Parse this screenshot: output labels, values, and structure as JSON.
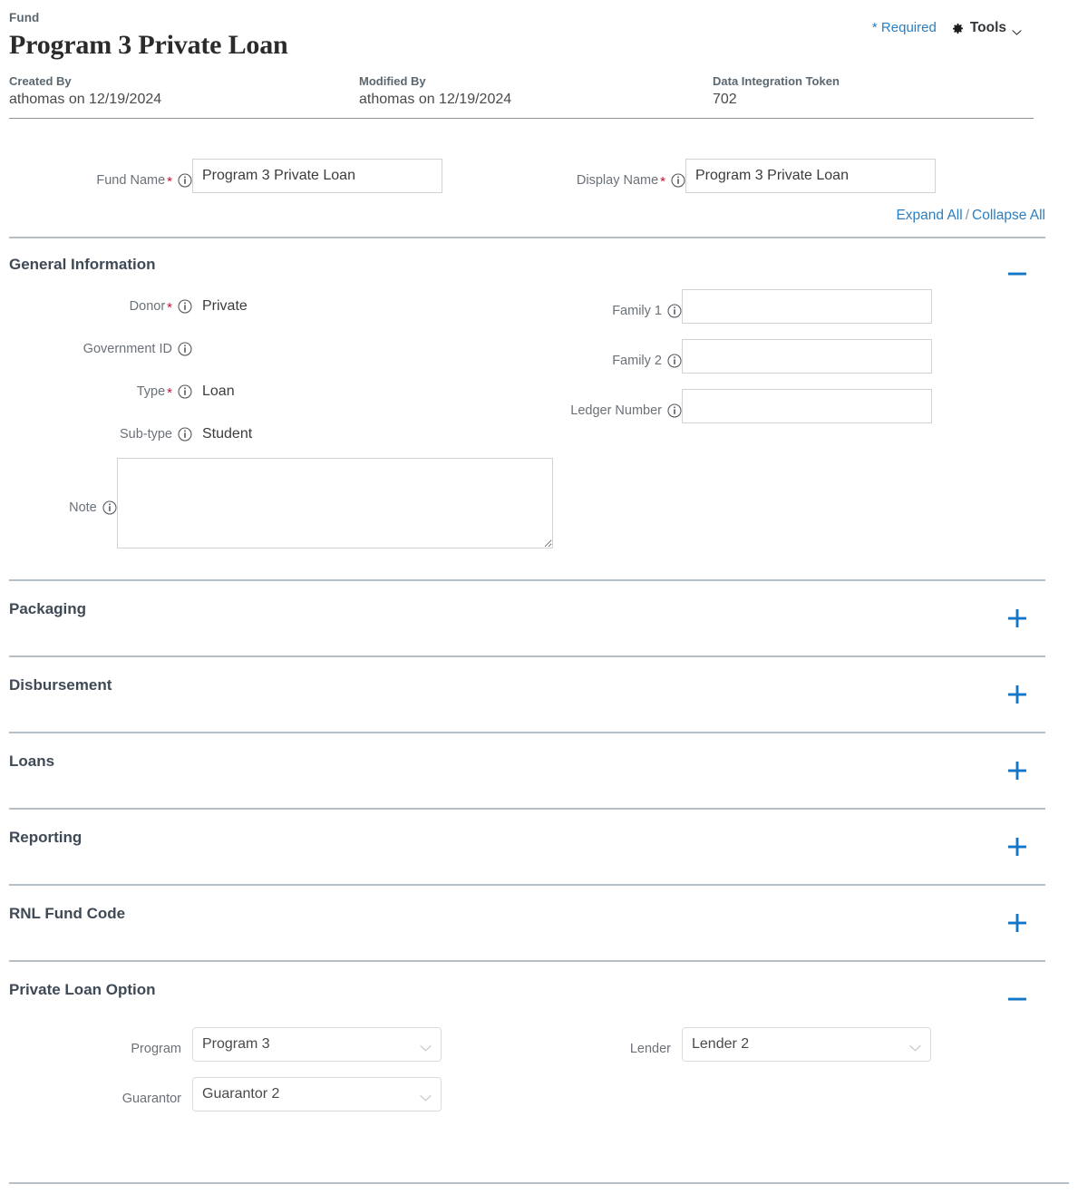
{
  "header": {
    "eyebrow": "Fund",
    "title": "Program 3 Private Loan",
    "required_label": "* Required",
    "tools_label": "Tools",
    "gear_icon": "gear-icon",
    "chevron_icon": "chevron-down-icon",
    "meta": [
      {
        "label": "Created By",
        "value": "athomas on 12/19/2024"
      },
      {
        "label": "Modified By",
        "value": "athomas on 12/19/2024"
      },
      {
        "label": "Data Integration Token",
        "value": "702"
      }
    ]
  },
  "name_row": {
    "fund_name": {
      "label": "Fund Name",
      "required": "*",
      "value": "Program 3 Private Loan",
      "placeholder": ""
    },
    "display_name": {
      "label": "Display Name",
      "required": "*",
      "value": "Program 3 Private Loan",
      "placeholder": ""
    }
  },
  "expand_bar": {
    "expand_all": "Expand All",
    "separator": "/",
    "collapse_all": "Collapse All"
  },
  "sections": {
    "general_information": {
      "title": "General Information",
      "state": "expanded",
      "toggle_icon": "minus-icon",
      "left_fields": [
        {
          "label": "Donor",
          "required": "*",
          "value": "Private",
          "type": "static"
        },
        {
          "label": "Government ID",
          "required": "",
          "value": "",
          "type": "static"
        },
        {
          "label": "Type",
          "required": "*",
          "value": "Loan",
          "type": "static"
        },
        {
          "label": "Sub-type",
          "required": "",
          "value": "Student",
          "type": "static"
        }
      ],
      "right_fields": [
        {
          "label": "Family 1",
          "required": "",
          "value": "",
          "type": "input"
        },
        {
          "label": "Family 2",
          "required": "",
          "value": "",
          "type": "input"
        },
        {
          "label": "Ledger Number",
          "required": "",
          "value": "",
          "type": "input"
        }
      ],
      "note": {
        "label": "Note",
        "required": "",
        "value": "",
        "type": "textarea"
      }
    },
    "collapsed": [
      {
        "title": "Packaging",
        "state": "collapsed",
        "toggle_icon": "plus-icon"
      },
      {
        "title": "Disbursement",
        "state": "collapsed",
        "toggle_icon": "plus-icon"
      },
      {
        "title": "Loans",
        "state": "collapsed",
        "toggle_icon": "plus-icon"
      },
      {
        "title": "Reporting",
        "state": "collapsed",
        "toggle_icon": "plus-icon"
      },
      {
        "title": "RNL Fund Code",
        "state": "collapsed",
        "toggle_icon": "plus-icon"
      }
    ],
    "private_loan_option": {
      "title": "Private Loan Option",
      "state": "expanded",
      "toggle_icon": "minus-icon",
      "left_fields": [
        {
          "label": "Program",
          "value": "Program 3",
          "type": "select"
        },
        {
          "label": "Guarantor",
          "value": "Guarantor 2",
          "type": "select"
        }
      ],
      "right_fields": [
        {
          "label": "Lender",
          "value": "Lender 2",
          "type": "select"
        }
      ]
    }
  },
  "colors": {
    "link_blue": "#2a7ec1",
    "required_red": "#c8102e",
    "toggle_blue": "#1476c6",
    "section_title": "#3f4a56",
    "label_gray": "#6b7178"
  }
}
